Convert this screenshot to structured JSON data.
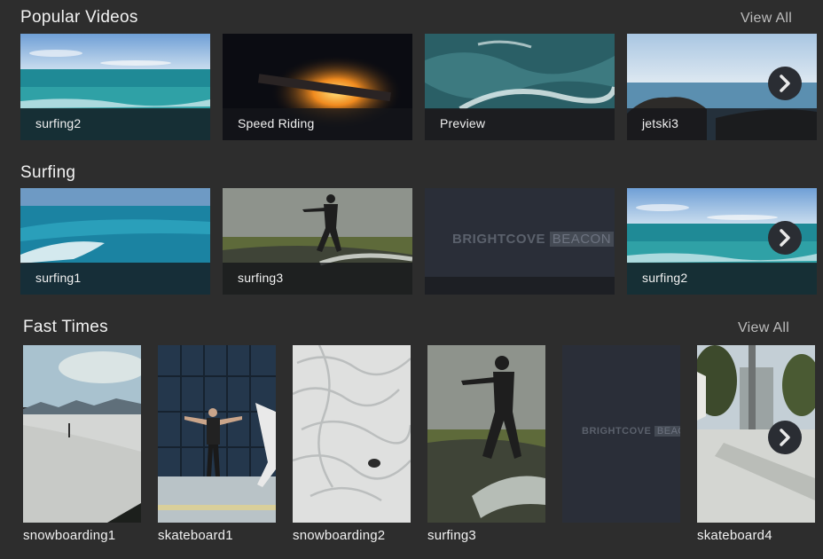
{
  "rows": [
    {
      "title": "Popular Videos",
      "view_all": "View All",
      "items": [
        {
          "label": "surfing2"
        },
        {
          "label": "Speed Riding"
        },
        {
          "label": "Preview"
        },
        {
          "label": "jetski3"
        }
      ]
    },
    {
      "title": "Surfing",
      "items": [
        {
          "label": "surfing1"
        },
        {
          "label": "surfing3"
        },
        {
          "label": ""
        },
        {
          "label": "surfing2"
        }
      ]
    },
    {
      "title": "Fast Times",
      "view_all": "View All",
      "items": [
        {
          "label": "snowboarding1"
        },
        {
          "label": "skateboard1"
        },
        {
          "label": "snowboarding2"
        },
        {
          "label": "surfing3"
        },
        {
          "label": ""
        },
        {
          "label": "skateboard4"
        }
      ]
    }
  ],
  "placeholder_logo": {
    "part1": "BRIGHTCOVE",
    "part2": "BEACON"
  },
  "icons": {
    "next": "chevron-right-icon"
  },
  "colors": {
    "background": "#2d2d2d",
    "caption_bar": "#14161a",
    "placeholder_tile": "#2a2e38"
  }
}
